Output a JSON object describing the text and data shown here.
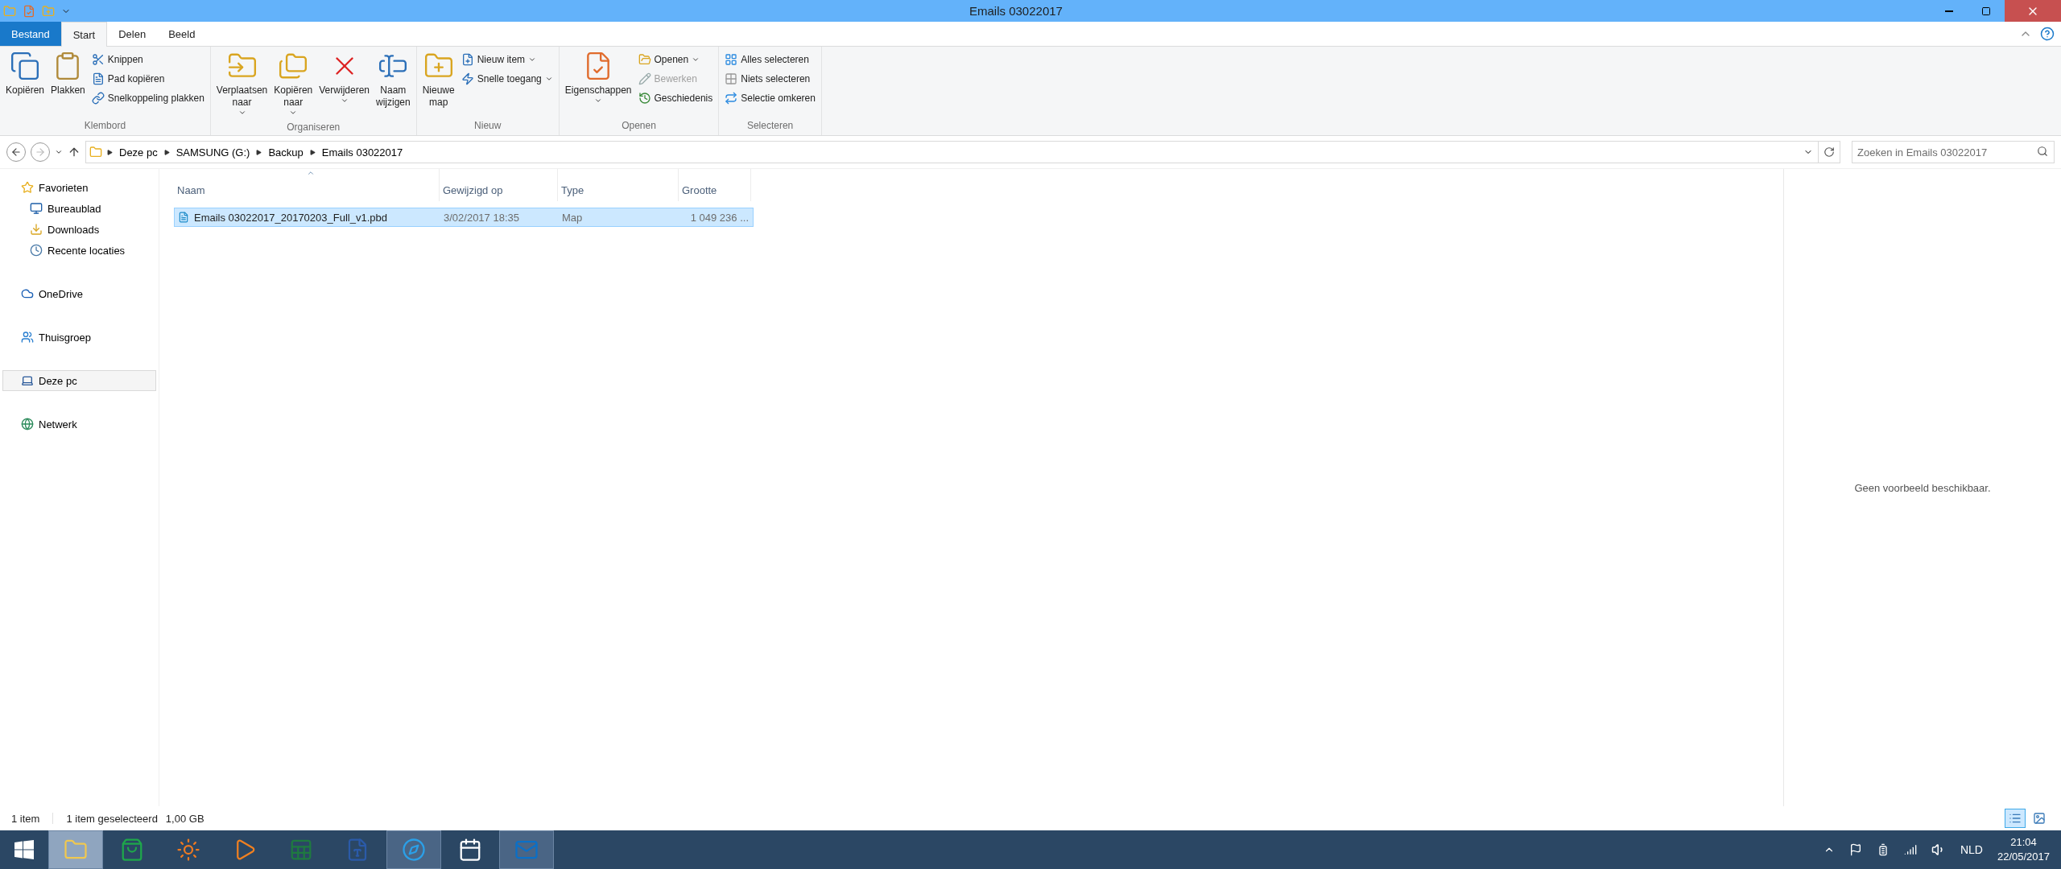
{
  "window": {
    "title": "Emails 03022017"
  },
  "ribbon_tabs": [
    {
      "label": "Bestand",
      "kind": "file",
      "selected": false
    },
    {
      "label": "Start",
      "kind": "tab",
      "selected": true
    },
    {
      "label": "Delen",
      "kind": "tab",
      "selected": false
    },
    {
      "label": "Beeld",
      "kind": "tab",
      "selected": false
    }
  ],
  "ribbon_groups": [
    {
      "label": "Klembord",
      "items": [
        {
          "kind": "large",
          "lines": [
            "Kopiëren"
          ],
          "dropdown": false,
          "disabled": false
        },
        {
          "kind": "large",
          "lines": [
            "Plakken"
          ],
          "dropdown": false,
          "disabled": false
        },
        {
          "kind": "small",
          "lines": [
            "Knippen"
          ],
          "dropdown": false,
          "disabled": false
        },
        {
          "kind": "small",
          "lines": [
            "Pad kopiëren"
          ],
          "dropdown": false,
          "disabled": false
        },
        {
          "kind": "small",
          "lines": [
            "Snelkoppeling plakken"
          ],
          "dropdown": false,
          "disabled": false
        }
      ]
    },
    {
      "label": "Organiseren",
      "items": [
        {
          "kind": "large",
          "lines": [
            "Verplaatsen",
            "naar"
          ],
          "dropdown": true,
          "disabled": false
        },
        {
          "kind": "large",
          "lines": [
            "Kopiëren",
            "naar"
          ],
          "dropdown": true,
          "disabled": false
        },
        {
          "kind": "large",
          "lines": [
            "Verwijderen"
          ],
          "dropdown": true,
          "disabled": false
        },
        {
          "kind": "large",
          "lines": [
            "Naam",
            "wijzigen"
          ],
          "dropdown": false,
          "disabled": false
        }
      ]
    },
    {
      "label": "Nieuw",
      "items": [
        {
          "kind": "large",
          "lines": [
            "Nieuwe",
            "map"
          ],
          "dropdown": false,
          "disabled": false
        },
        {
          "kind": "small",
          "lines": [
            "Nieuw item"
          ],
          "dropdown": true,
          "disabled": false
        },
        {
          "kind": "small",
          "lines": [
            "Snelle toegang"
          ],
          "dropdown": true,
          "disabled": false
        }
      ]
    },
    {
      "label": "Openen",
      "items": [
        {
          "kind": "large",
          "lines": [
            "Eigenschappen"
          ],
          "dropdown": true,
          "disabled": false
        },
        {
          "kind": "small",
          "lines": [
            "Openen"
          ],
          "dropdown": true,
          "disabled": false
        },
        {
          "kind": "small",
          "lines": [
            "Bewerken"
          ],
          "dropdown": false,
          "disabled": true
        },
        {
          "kind": "small",
          "lines": [
            "Geschiedenis"
          ],
          "dropdown": false,
          "disabled": false
        }
      ]
    },
    {
      "label": "Selecteren",
      "items": [
        {
          "kind": "small",
          "lines": [
            "Alles selecteren"
          ],
          "dropdown": false,
          "disabled": false
        },
        {
          "kind": "small",
          "lines": [
            "Niets selecteren"
          ],
          "dropdown": false,
          "disabled": false
        },
        {
          "kind": "small",
          "lines": [
            "Selectie omkeren"
          ],
          "dropdown": false,
          "disabled": false
        }
      ]
    }
  ],
  "address": {
    "crumbs": [
      "Deze pc",
      "SAMSUNG (G:)",
      "Backup",
      "Emails 03022017"
    ]
  },
  "search": {
    "placeholder": "Zoeken in Emails 03022017"
  },
  "navigation": [
    {
      "label": "Favorieten",
      "selected": false,
      "children": [
        {
          "label": "Bureaublad",
          "selected": false
        },
        {
          "label": "Downloads",
          "selected": false
        },
        {
          "label": "Recente locaties",
          "selected": false
        }
      ]
    },
    {
      "label": "OneDrive",
      "selected": false
    },
    {
      "label": "Thuisgroep",
      "selected": false
    },
    {
      "label": "Deze pc",
      "selected": true
    },
    {
      "label": "Netwerk",
      "selected": false
    }
  ],
  "columns": [
    {
      "label": "Naam",
      "sorted": true
    },
    {
      "label": "Gewijzigd op",
      "sorted": false
    },
    {
      "label": "Type",
      "sorted": false
    },
    {
      "label": "Grootte",
      "sorted": false
    }
  ],
  "rows": [
    {
      "name": "Emails 03022017_20170203_Full_v1.pbd",
      "modified": "3/02/2017 18:35",
      "type": "Map",
      "size": "1 049 236 ...",
      "selected": true
    }
  ],
  "preview": {
    "message": "Geen voorbeeld beschikbaar."
  },
  "status_bar": {
    "count": "1 item",
    "selection": "1 item geselecteerd",
    "size": "1,00 GB"
  },
  "view_buttons": [
    {
      "selected": true
    },
    {
      "selected": false
    }
  ],
  "taskbar": {
    "apps": [
      {
        "selected": true,
        "running": true
      },
      {
        "selected": false,
        "running": false
      },
      {
        "selected": false,
        "running": false
      },
      {
        "selected": false,
        "running": false
      },
      {
        "selected": false,
        "running": false
      },
      {
        "selected": false,
        "running": false
      },
      {
        "selected": false,
        "running": true
      },
      {
        "selected": false,
        "running": false
      },
      {
        "selected": false,
        "running": true
      }
    ],
    "language": "NLD",
    "time": "21:04",
    "date": "22/05/2017"
  }
}
